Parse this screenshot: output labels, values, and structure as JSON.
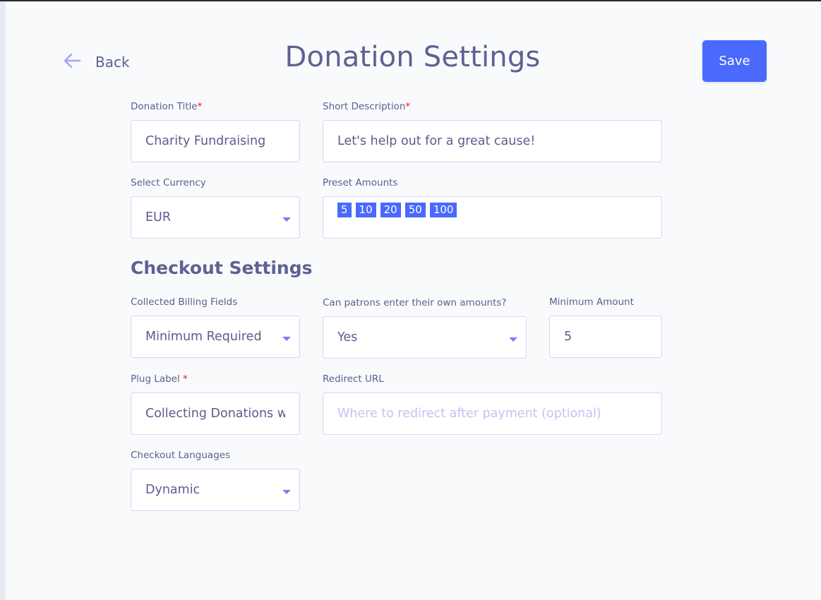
{
  "header": {
    "back_label": "Back",
    "title": "Donation Settings",
    "save_label": "Save"
  },
  "donation": {
    "title": {
      "label": "Donation Title",
      "required_mark": "*",
      "value": "Charity Fundraising"
    },
    "short_description": {
      "label": "Short Description",
      "required_mark": "*",
      "value": "Let's help out for a great cause!"
    },
    "currency": {
      "label": "Select Currency",
      "value": "EUR"
    },
    "preset_amounts": {
      "label": "Preset Amounts",
      "values": [
        "5",
        "10",
        "20",
        "50",
        "100"
      ]
    }
  },
  "checkout": {
    "section_title": "Checkout Settings",
    "billing_fields": {
      "label": "Collected Billing Fields",
      "value": "Minimum Required"
    },
    "own_amounts": {
      "label": "Can patrons enter their own amounts?",
      "value": "Yes"
    },
    "minimum_amount": {
      "label": "Minimum Amount",
      "value": "5"
    },
    "plug_label": {
      "label": "Plug Label ",
      "required_mark": "*",
      "value": "Collecting Donations with"
    },
    "redirect_url": {
      "label": "Redirect URL",
      "value": "",
      "placeholder": "Where to redirect after payment (optional)"
    },
    "languages": {
      "label": "Checkout Languages",
      "value": "Dynamic"
    }
  },
  "colors": {
    "accent": "#4a69fd",
    "text": "#5e6192",
    "required": "#e02020",
    "border": "#d3d5f5",
    "placeholder": "#c2c4f4",
    "background": "#f9fafc"
  }
}
